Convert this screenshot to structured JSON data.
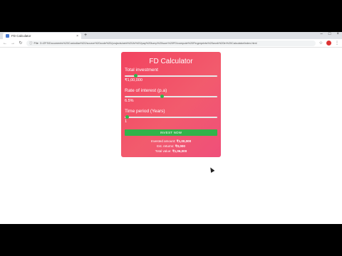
{
  "browser": {
    "tab_title": "FD Calculator",
    "tab_close": "×",
    "new_tab": "+",
    "window_controls": [
      "–",
      "□",
      "×"
    ],
    "omnibox_label": "File",
    "url": "D:/ZFS/Documents%20Custodian%20/source%20code%20/projects/web%20AI%20/pay%20lump%20sum%20FD/compute%20Fingerprints%20work%20in%20Calculator/index.html",
    "icons": [
      "back-icon",
      "forward-icon",
      "reload-icon",
      "info-icon",
      "star-icon",
      "extension-icon",
      "menu-icon"
    ]
  },
  "calculator": {
    "title": "FD Calculator",
    "fields": [
      {
        "label": "Total investment",
        "value": "₹1,00,000",
        "slider_fraction": 0.12
      },
      {
        "label": "Rate of interest (p.a)",
        "value": "6.5%",
        "slider_fraction": 0.4
      },
      {
        "label": "Time period (Years)",
        "value": "1",
        "slider_fraction": 0.03
      }
    ],
    "button_label": "INVEST NOW",
    "summary": [
      {
        "label": "Invested amount:",
        "value": "₹1,00,000"
      },
      {
        "label": "Est. returns:",
        "value": "₹0,000"
      },
      {
        "label": "Total value:",
        "value": "₹1,06,000"
      }
    ]
  },
  "colors": {
    "card_start": "#f2435f",
    "card_end": "#ef4f7a",
    "accent_green": "#2bb94a",
    "button_green": "#31b34a"
  }
}
